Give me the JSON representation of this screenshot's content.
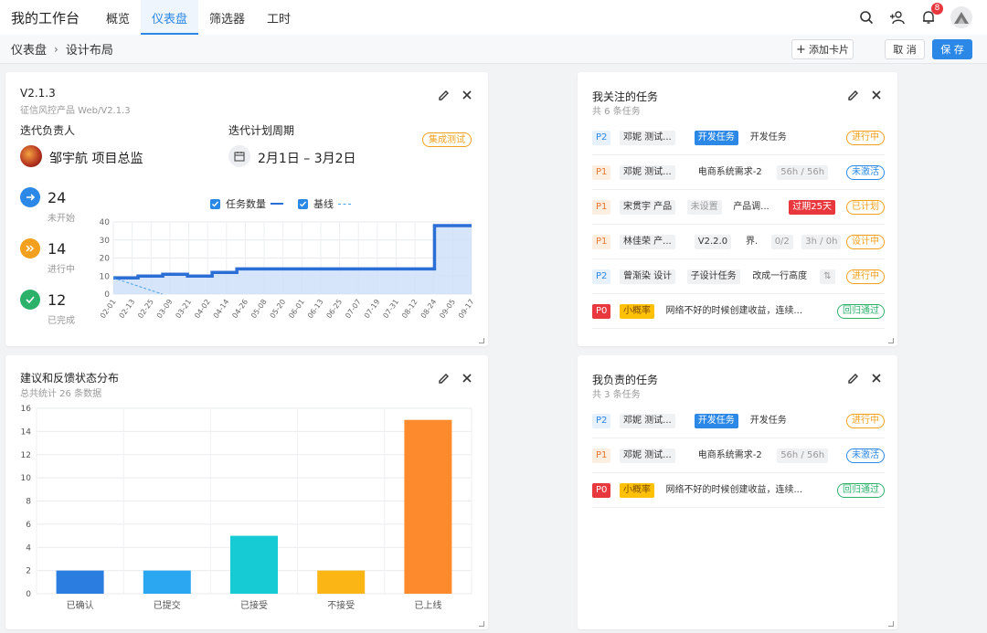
{
  "nav": {
    "brand": "我的工作台",
    "tabs": [
      {
        "label": "概览"
      },
      {
        "label": "仪表盘"
      },
      {
        "label": "筛选器"
      },
      {
        "label": "工时"
      }
    ],
    "notification_count": "8"
  },
  "breadcrumb": {
    "items": [
      "仪表盘",
      "设计布局"
    ],
    "add_card": "添加卡片",
    "cancel": "取 消",
    "save": "保 存"
  },
  "iteration": {
    "title": "V2.1.3",
    "subtitle": "征信风控产品 Web/V2.1.3",
    "owner_label": "迭代负责人",
    "owner_name": "邹宇航 项目总监",
    "period_label": "迭代计划周期",
    "period": "2月1日 – 3月2日",
    "stage_tag": "集成测试",
    "stats": [
      {
        "value": "24",
        "label": "未开始",
        "color": "#2b88e6"
      },
      {
        "value": "14",
        "label": "进行中",
        "color": "#f2a01e"
      },
      {
        "value": "12",
        "label": "已完成",
        "color": "#2cb16a"
      }
    ],
    "legend": {
      "series1": "任务数量",
      "series2": "基线"
    }
  },
  "chart_data": [
    {
      "type": "area",
      "title": "",
      "xlabel": "",
      "ylabel": "",
      "ylim": [
        0,
        40
      ],
      "yticks": [
        0,
        10,
        20,
        30,
        40
      ],
      "x": [
        "02-01",
        "02-13",
        "02-25",
        "03-09",
        "03-21",
        "04-02",
        "04-14",
        "04-26",
        "05-08",
        "05-20",
        "06-01",
        "06-13",
        "06-25",
        "07-07",
        "07-19",
        "07-31",
        "08-12",
        "08-24",
        "09-05",
        "09-17"
      ],
      "series": [
        {
          "name": "任务数量",
          "color": "#2b6fd6",
          "values": [
            9,
            9,
            10,
            10,
            11,
            11,
            10,
            10,
            12,
            12,
            14,
            14,
            14,
            14,
            14,
            14,
            14,
            14,
            14,
            14,
            14,
            14,
            14,
            14,
            14,
            14,
            38,
            38,
            38,
            38
          ]
        },
        {
          "name": "基线",
          "color": "#4aa3e8",
          "values": [
            9,
            0
          ]
        }
      ],
      "legend": "top",
      "grid": true
    },
    {
      "type": "bar",
      "title": "建议和反馈状态分布",
      "subtitle": "总共统计 26 条数据",
      "categories": [
        "已确认",
        "已提交",
        "已接受",
        "不接受",
        "已上线"
      ],
      "values": [
        2,
        2,
        5,
        2,
        15
      ],
      "colors": [
        "#2b7de0",
        "#2aa7f0",
        "#17cbd5",
        "#fbb615",
        "#fd8a2c"
      ],
      "ylim": [
        0,
        16
      ],
      "yticks": [
        0,
        2,
        4,
        6,
        8,
        10,
        12,
        14,
        16
      ],
      "grid": true
    }
  ],
  "watched": {
    "title": "我关注的任务",
    "subtitle": "共 6 条任务",
    "rows": [
      {
        "priority": "P2",
        "chips": [
          {
            "text": "邓妮 测试...",
            "kind": "person"
          },
          {
            "text": "开发任务",
            "kind": "blue-chip"
          },
          {
            "text": "开发任务",
            "kind": "gray-text"
          }
        ],
        "status": "进行中",
        "status_color": "#f2a01e"
      },
      {
        "priority": "P1",
        "chips": [
          {
            "text": "邓妮 测试...",
            "kind": "person"
          },
          {
            "text": "电商系统需求-2",
            "kind": "gray-text"
          },
          {
            "text": "56h / 56h",
            "kind": "gray-chip"
          }
        ],
        "status": "未激活",
        "status_color": "#2b88e6"
      },
      {
        "priority": "P1",
        "chips": [
          {
            "text": "宋贯宇 产品",
            "kind": "person"
          },
          {
            "text": "未设置",
            "kind": "gray-chip"
          },
          {
            "text": "产品调...",
            "kind": "gray-text"
          },
          {
            "text": "过期25天",
            "kind": "red-chip"
          }
        ],
        "status": "已计划",
        "status_color": "#f2a01e"
      },
      {
        "priority": "P1",
        "chips": [
          {
            "text": "林佳荣 产...",
            "kind": "person"
          },
          {
            "text": "V2.2.0",
            "kind": "person"
          },
          {
            "text": "界.",
            "kind": "gray-text"
          },
          {
            "text": "0/2",
            "kind": "gray-chip"
          },
          {
            "text": "3h / 0h",
            "kind": "gray-chip"
          }
        ],
        "status": "设计中",
        "status_color": "#f2a01e"
      },
      {
        "priority": "P2",
        "chips": [
          {
            "text": "曾渐染 设计",
            "kind": "person"
          },
          {
            "text": "子设计任务",
            "kind": "person"
          },
          {
            "text": "改成一行高度",
            "kind": "gray-text"
          },
          {
            "text": "⇅",
            "kind": "gray-chip"
          }
        ],
        "status": "进行中",
        "status_color": "#f2a01e"
      },
      {
        "priority": "P0",
        "chips": [
          {
            "text": "小概率",
            "kind": "yellow-chip"
          },
          {
            "text": "网络不好的时候创建收益，连续...",
            "kind": "gray-text"
          }
        ],
        "status": "回归通过",
        "status_color": "#2cb16a"
      }
    ]
  },
  "owned": {
    "title": "我负责的任务",
    "subtitle": "共 3 条任务",
    "rows": [
      {
        "priority": "P2",
        "chips": [
          {
            "text": "邓妮 测试...",
            "kind": "person"
          },
          {
            "text": "开发任务",
            "kind": "blue-chip"
          },
          {
            "text": "开发任务",
            "kind": "gray-text"
          }
        ],
        "status": "进行中",
        "status_color": "#f2a01e"
      },
      {
        "priority": "P1",
        "chips": [
          {
            "text": "邓妮 测试...",
            "kind": "person"
          },
          {
            "text": "电商系统需求-2",
            "kind": "gray-text"
          },
          {
            "text": "56h / 56h",
            "kind": "gray-chip"
          }
        ],
        "status": "未激活",
        "status_color": "#2b88e6"
      },
      {
        "priority": "P0",
        "chips": [
          {
            "text": "小概率",
            "kind": "yellow-chip"
          },
          {
            "text": "网络不好的时候创建收益，连续...",
            "kind": "gray-text"
          }
        ],
        "status": "回归通过",
        "status_color": "#2cb16a"
      }
    ]
  }
}
